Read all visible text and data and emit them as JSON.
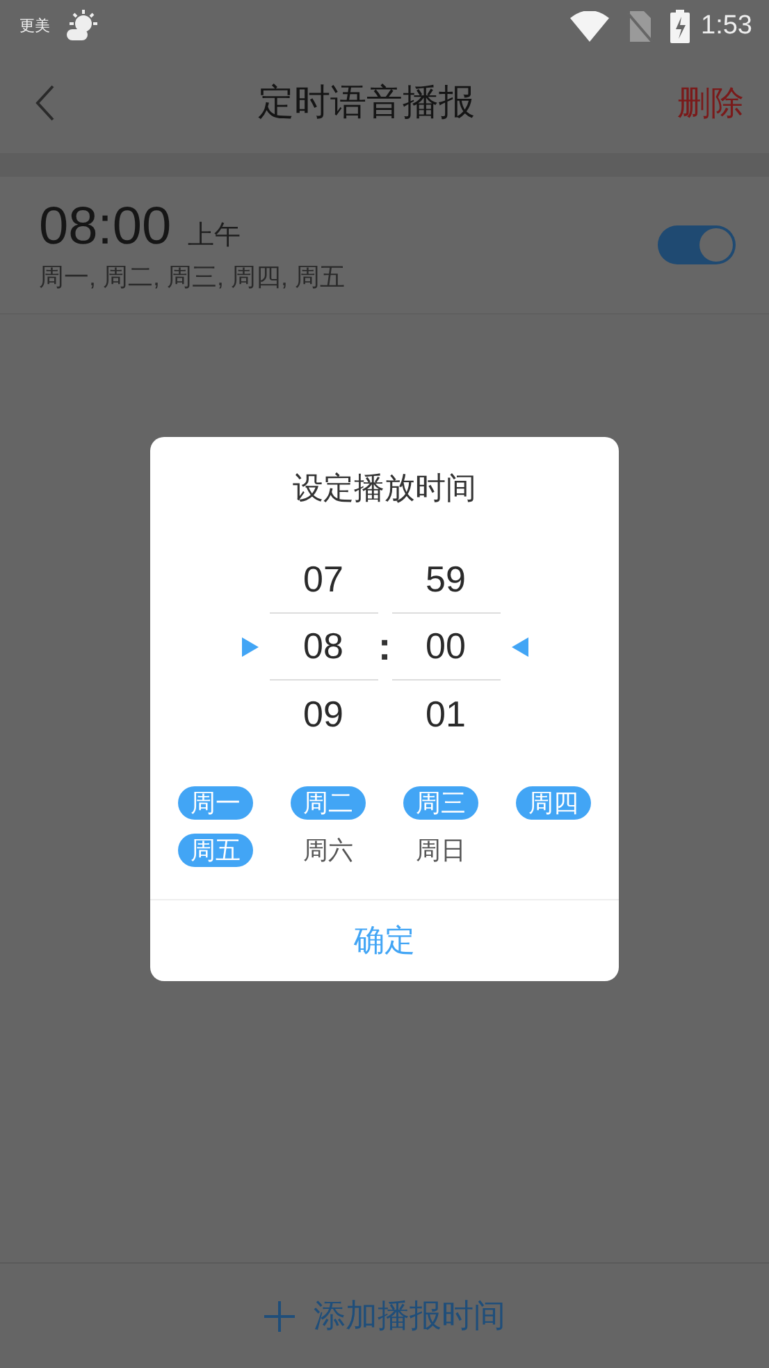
{
  "status_bar": {
    "carrier": "更美",
    "time": "1:53"
  },
  "toolbar": {
    "title": "定时语音播报",
    "action": "删除"
  },
  "schedules": [
    {
      "time": "08:00",
      "period": "上午",
      "days": "周一, 周二, 周三, 周四, 周五",
      "on": true
    }
  ],
  "dialog": {
    "title": "设定播放时间",
    "separator": ":",
    "hours": [
      {
        "label": "07",
        "selected": false
      },
      {
        "label": "08",
        "selected": true
      },
      {
        "label": "09",
        "selected": false
      }
    ],
    "minutes": [
      {
        "label": "59",
        "selected": false
      },
      {
        "label": "00",
        "selected": true
      },
      {
        "label": "01",
        "selected": false
      }
    ],
    "days": [
      {
        "label": "周一",
        "selected": true
      },
      {
        "label": "周二",
        "selected": true
      },
      {
        "label": "周三",
        "selected": true
      },
      {
        "label": "周四",
        "selected": true
      },
      {
        "label": "周五",
        "selected": true
      },
      {
        "label": "周六",
        "selected": false
      },
      {
        "label": "周日",
        "selected": false
      }
    ],
    "confirm": "确定"
  },
  "add_button": {
    "label": "添加播报时间"
  }
}
